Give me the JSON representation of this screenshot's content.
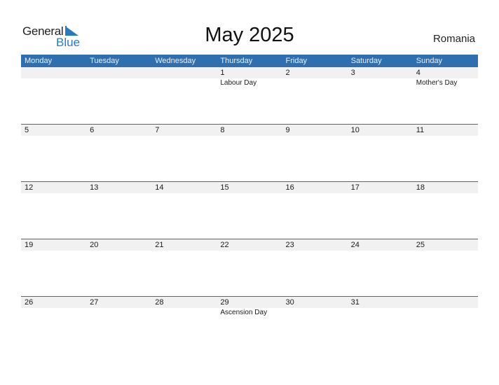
{
  "logo": {
    "general": "General",
    "blue": "Blue"
  },
  "title": "May 2025",
  "country": "Romania",
  "colors": {
    "header_bg": "#2f6fb0",
    "accent": "#2a7ac0",
    "row_bg": "#f1f1f1"
  },
  "weekdays": [
    "Monday",
    "Tuesday",
    "Wednesday",
    "Thursday",
    "Friday",
    "Saturday",
    "Sunday"
  ],
  "weeks": [
    {
      "days": [
        "",
        "",
        "",
        "1",
        "2",
        "3",
        "4"
      ],
      "holidays": [
        "",
        "",
        "",
        "Labour Day",
        "",
        "",
        "Mother's Day"
      ]
    },
    {
      "days": [
        "5",
        "6",
        "7",
        "8",
        "9",
        "10",
        "11"
      ],
      "holidays": [
        "",
        "",
        "",
        "",
        "",
        "",
        ""
      ]
    },
    {
      "days": [
        "12",
        "13",
        "14",
        "15",
        "16",
        "17",
        "18"
      ],
      "holidays": [
        "",
        "",
        "",
        "",
        "",
        "",
        ""
      ]
    },
    {
      "days": [
        "19",
        "20",
        "21",
        "22",
        "23",
        "24",
        "25"
      ],
      "holidays": [
        "",
        "",
        "",
        "",
        "",
        "",
        ""
      ]
    },
    {
      "days": [
        "26",
        "27",
        "28",
        "29",
        "30",
        "31",
        ""
      ],
      "holidays": [
        "",
        "",
        "",
        "Ascension Day",
        "",
        "",
        ""
      ]
    }
  ]
}
